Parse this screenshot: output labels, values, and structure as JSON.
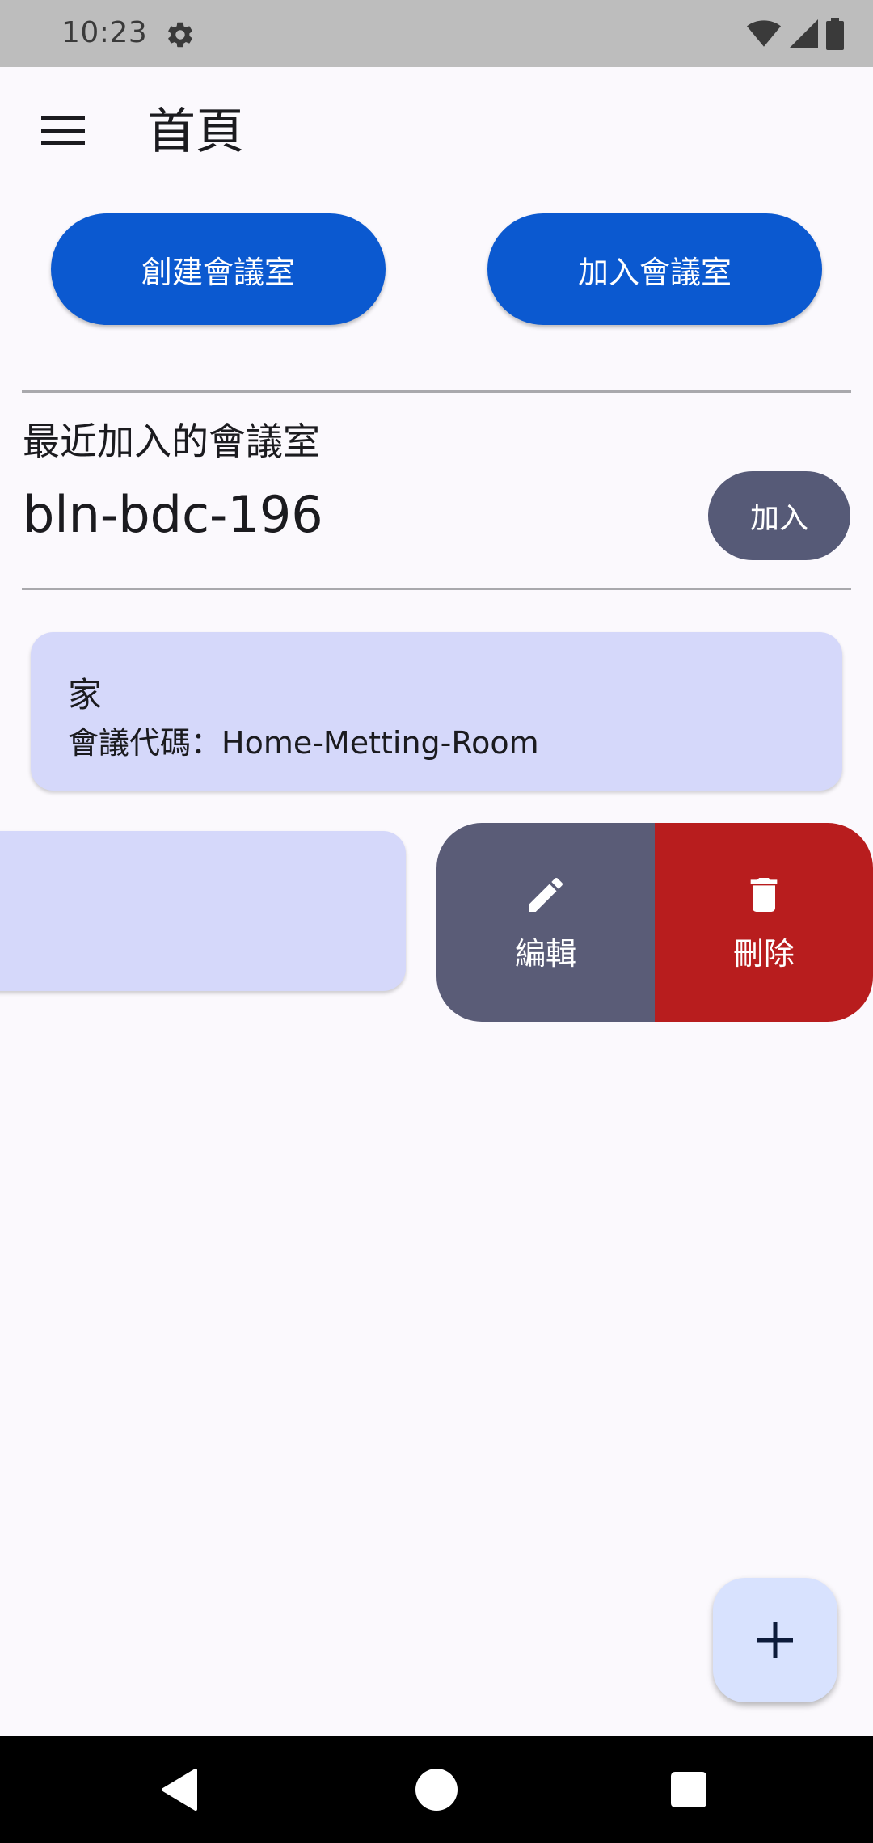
{
  "status_bar": {
    "time": "10:23",
    "icons": [
      "gear-icon",
      "wifi-icon",
      "cell-signal-icon",
      "battery-icon"
    ]
  },
  "app_bar": {
    "menu_icon": "menu-icon",
    "title": "首頁"
  },
  "actions": {
    "create_room_label": "創建會議室",
    "join_room_label": "加入會議室"
  },
  "recent": {
    "label": "最近加入的會議室",
    "code": "bln-bdc-196",
    "join_label": "加入"
  },
  "rooms": [
    {
      "name": "家",
      "code_line": "會議代碼：Home-Metting-Room"
    }
  ],
  "swipe_actions": {
    "edit_label": "編輯",
    "edit_icon": "pencil-icon",
    "delete_label": "刪除",
    "delete_icon": "trash-icon"
  },
  "fab": {
    "icon": "plus-icon"
  },
  "colors": {
    "primary": "#0b59d0",
    "secondary": "#565a77",
    "card": "#d5d8fa",
    "danger": "#b81d1e",
    "fab": "#d8e2fe"
  }
}
